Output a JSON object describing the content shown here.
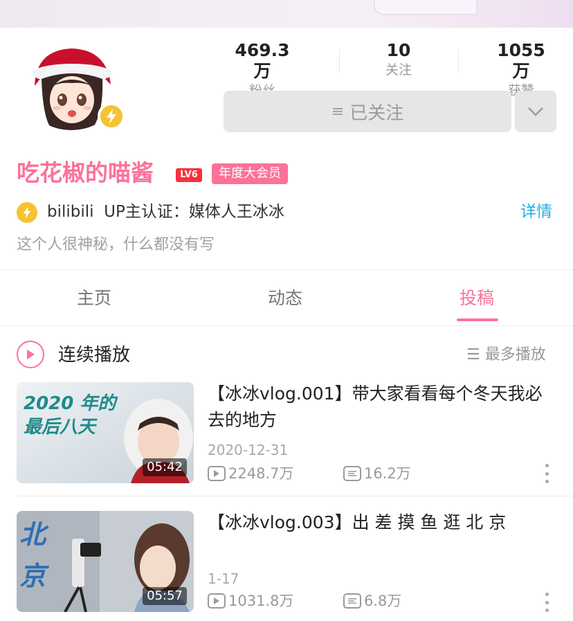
{
  "profile": {
    "name": "吃花椒的喵酱",
    "level_badge": "LV6",
    "vip_badge": "年度大会员",
    "cert_text": "bilibili  UP主认证：媒体人王冰冰",
    "detail_link": "详情",
    "bio": "这个人很神秘，什么都没有写"
  },
  "stats": [
    {
      "value": "469.3万",
      "label": "粉丝"
    },
    {
      "value": "10",
      "label": "关注"
    },
    {
      "value": "1055万",
      "label": "获赞"
    }
  ],
  "follow_button": {
    "icon": "≡",
    "label": "已关注"
  },
  "tabs": [
    {
      "label": "主页"
    },
    {
      "label": "动态"
    },
    {
      "label": "投稿",
      "active": true
    }
  ],
  "list_header": {
    "play_all": "连续播放",
    "sort_icon": "☰",
    "sort_label": "最多播放"
  },
  "videos": [
    {
      "title": "【冰冰vlog.001】带大家看看每个冬天我必去的地方",
      "date": "2020-12-31",
      "duration": "05:42",
      "views": "2248.7万",
      "danmaku": "16.2万",
      "thumb_text": "2020 年的最后八天"
    },
    {
      "title": "【冰冰vlog.003】出 差 摸 鱼 逛 北 京",
      "date": "1-17",
      "duration": "05:57",
      "views": "1031.8万",
      "danmaku": "6.8万",
      "thumb_text": "北京"
    }
  ],
  "colors": {
    "brand_pink": "#fb7299",
    "link_blue": "#23ade5",
    "badge_yellow": "#f6c231"
  }
}
